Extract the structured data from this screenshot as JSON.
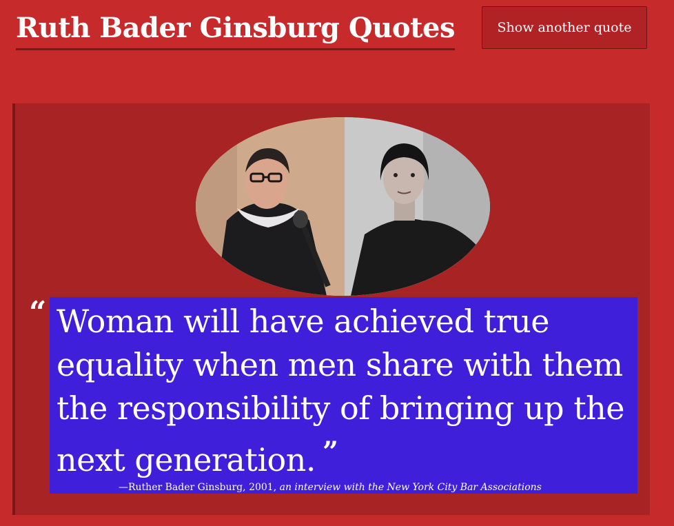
{
  "header": {
    "title": "Ruth Bader Ginsburg Quotes",
    "new_quote_label": "Show another quote"
  },
  "quote": {
    "open_mark": "“",
    "text": "Woman will have achieved true equality when men share with them the responsibility of bringing up the next generation.",
    "close_mark": "”",
    "author": "—Ruther Bader Ginsburg",
    "year": "2001",
    "source": "an interview with the New York City Bar Associations"
  },
  "colors": {
    "page_background": "#c62a2b",
    "card_background": "#a82324",
    "quote_highlight": "#3f1fd9",
    "text": "#ffffff"
  }
}
